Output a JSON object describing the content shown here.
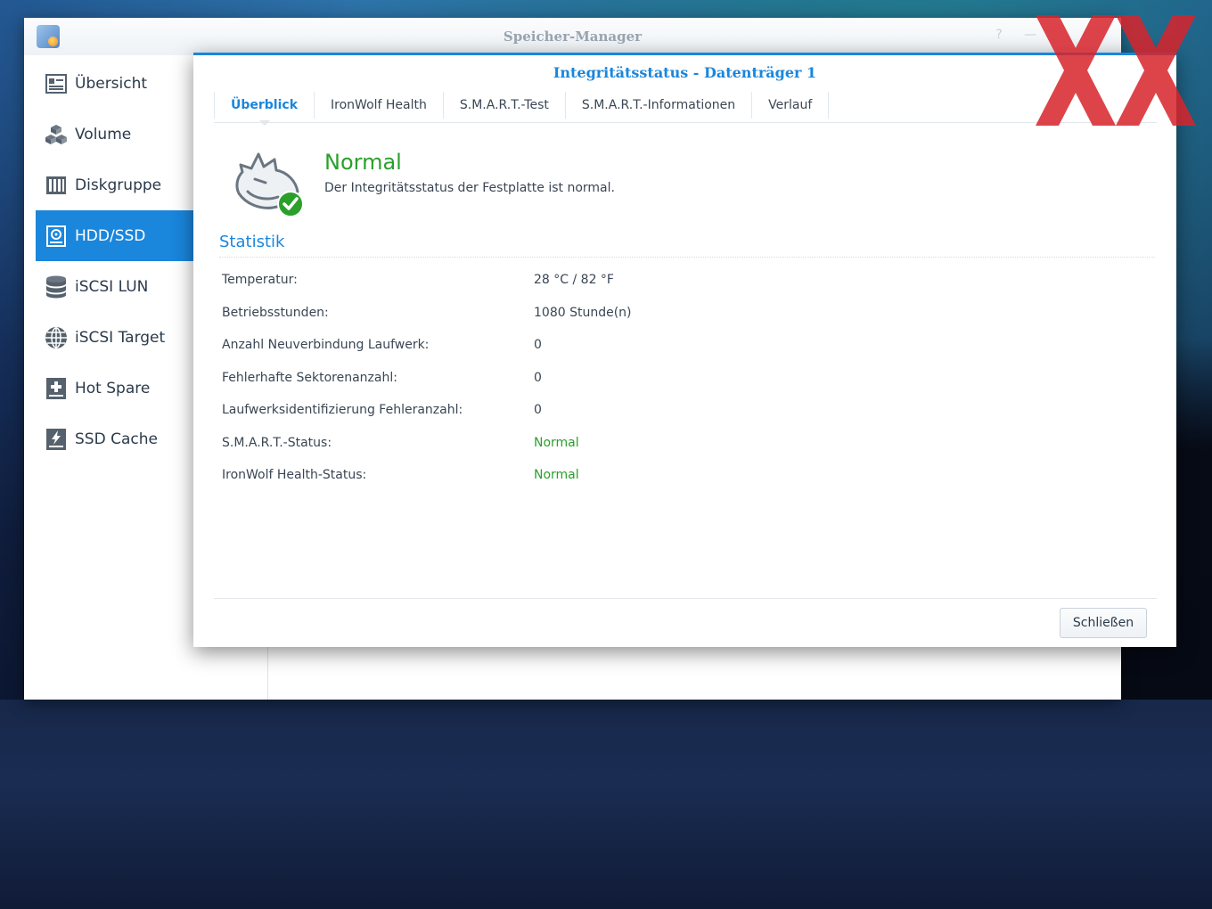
{
  "window": {
    "title": "Speicher-Manager",
    "controls": [
      "?",
      "—"
    ]
  },
  "sidebar": {
    "items": [
      {
        "label": "Übersicht",
        "icon": "overview-icon",
        "active": false
      },
      {
        "label": "Volume",
        "icon": "cubes-icon",
        "active": false
      },
      {
        "label": "Diskgruppe",
        "icon": "disk-group-icon",
        "active": false
      },
      {
        "label": "HDD/SSD",
        "icon": "hdd-icon",
        "active": true
      },
      {
        "label": "iSCSI LUN",
        "icon": "database-icon",
        "active": false
      },
      {
        "label": "iSCSI Target",
        "icon": "globe-icon",
        "active": false
      },
      {
        "label": "Hot Spare",
        "icon": "plus-box-icon",
        "active": false
      },
      {
        "label": "SSD Cache",
        "icon": "lightning-box-icon",
        "active": false
      }
    ]
  },
  "dialog": {
    "title": "Integritätsstatus - Datenträger 1",
    "tabs": [
      {
        "label": "Überblick",
        "active": true
      },
      {
        "label": "IronWolf Health",
        "active": false
      },
      {
        "label": "S.M.A.R.T.-Test",
        "active": false
      },
      {
        "label": "S.M.A.R.T.-Informationen",
        "active": false
      },
      {
        "label": "Verlauf",
        "active": false
      }
    ],
    "status": {
      "title": "Normal",
      "description": "Der Integritätsstatus der Festplatte ist normal."
    },
    "section_title": "Statistik",
    "stats": [
      {
        "label": "Temperatur:",
        "value": "28 °C / 82 °F",
        "ok": false
      },
      {
        "label": "Betriebsstunden:",
        "value": "1080 Stunde(n)",
        "ok": false
      },
      {
        "label": "Anzahl Neuverbindung Laufwerk:",
        "value": "0",
        "ok": false
      },
      {
        "label": "Fehlerhafte Sektorenanzahl:",
        "value": "0",
        "ok": false
      },
      {
        "label": "Laufwerksidentifizierung Fehleranzahl:",
        "value": "0",
        "ok": false
      },
      {
        "label": "S.M.A.R.T.-Status:",
        "value": "Normal",
        "ok": true
      },
      {
        "label": "IronWolf Health-Status:",
        "value": "Normal",
        "ok": true
      }
    ],
    "close_label": "Schließen"
  },
  "colors": {
    "accent": "#1a86dc",
    "ok_green": "#2aa02a",
    "watermark_red": "#d8242b"
  }
}
